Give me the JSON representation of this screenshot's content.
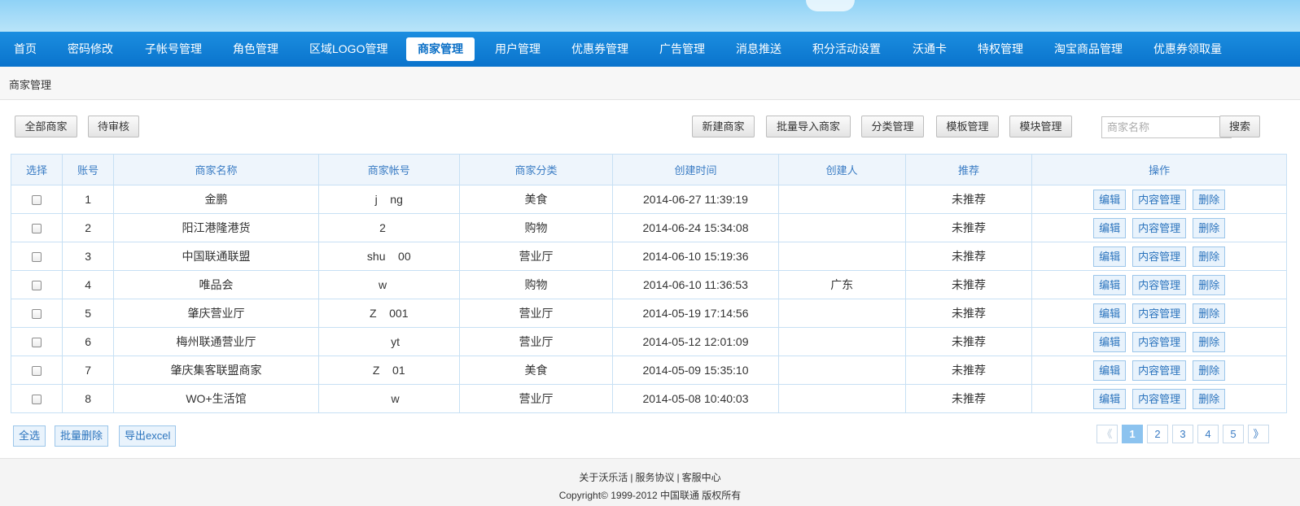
{
  "nav": {
    "items": [
      "首页",
      "密码修改",
      "子帐号管理",
      "角色管理",
      "区域LOGO管理",
      "商家管理",
      "用户管理",
      "优惠券管理",
      "广告管理",
      "消息推送",
      "积分活动设置",
      "沃通卡",
      "特权管理",
      "淘宝商品管理",
      "优惠券领取量"
    ],
    "active": "商家管理"
  },
  "breadcrumb": "商家管理",
  "filters": {
    "all_label": "全部商家",
    "pending_label": "待审核"
  },
  "toolbar": {
    "new_label": "新建商家",
    "import_label": "批量导入商家",
    "category_label": "分类管理",
    "template_label": "模板管理",
    "module_label": "模块管理",
    "search_placeholder": "商家名称",
    "search_label": "搜索"
  },
  "table": {
    "columns": [
      "选择",
      "账号",
      "商家名称",
      "商家帐号",
      "商家分类",
      "创建时间",
      "创建人",
      "推荐",
      "操作"
    ],
    "rows": [
      {
        "id": "1",
        "name": "金鹏",
        "account": "j    ng",
        "category": "美食",
        "created": "2014-06-27 11:39:19",
        "creator": "",
        "recommend": "未推荐"
      },
      {
        "id": "2",
        "name": "阳江港隆港货",
        "account": "2    ",
        "category": "购物",
        "created": "2014-06-24 15:34:08",
        "creator": "",
        "recommend": "未推荐"
      },
      {
        "id": "3",
        "name": "中国联通联盟",
        "account": "shu    00",
        "category": "营业厅",
        "created": "2014-06-10 15:19:36",
        "creator": "",
        "recommend": "未推荐"
      },
      {
        "id": "4",
        "name": "唯品会",
        "account": "w    ",
        "category": "购物",
        "created": "2014-06-10 11:36:53",
        "creator": "广东",
        "recommend": "未推荐"
      },
      {
        "id": "5",
        "name": "肇庆营业厅",
        "account": "Z    001",
        "category": "营业厅",
        "created": "2014-05-19 17:14:56",
        "creator": "",
        "recommend": "未推荐"
      },
      {
        "id": "6",
        "name": "梅州联通营业厅",
        "account": "    yt",
        "category": "营业厅",
        "created": "2014-05-12 12:01:09",
        "creator": "",
        "recommend": "未推荐"
      },
      {
        "id": "7",
        "name": "肇庆集客联盟商家",
        "account": "Z    01",
        "category": "美食",
        "created": "2014-05-09 15:35:10",
        "creator": "",
        "recommend": "未推荐"
      },
      {
        "id": "8",
        "name": "WO+生活馆",
        "account": "    w",
        "category": "营业厅",
        "created": "2014-05-08 10:40:03",
        "creator": "",
        "recommend": "未推荐"
      }
    ],
    "actions": {
      "edit": "编辑",
      "content": "内容管理",
      "delete": "删除"
    }
  },
  "bottom": {
    "select_all": "全选",
    "batch_delete": "批量删除",
    "export": "导出excel"
  },
  "pagination": {
    "prev": "《",
    "pages": [
      "1",
      "2",
      "3",
      "4",
      "5"
    ],
    "current": "1",
    "next": "》"
  },
  "footer": {
    "links": [
      "关于沃乐活",
      "服务协议",
      "客服中心"
    ],
    "copyright": "Copyright© 1999-2012 中国联通 版权所有"
  }
}
